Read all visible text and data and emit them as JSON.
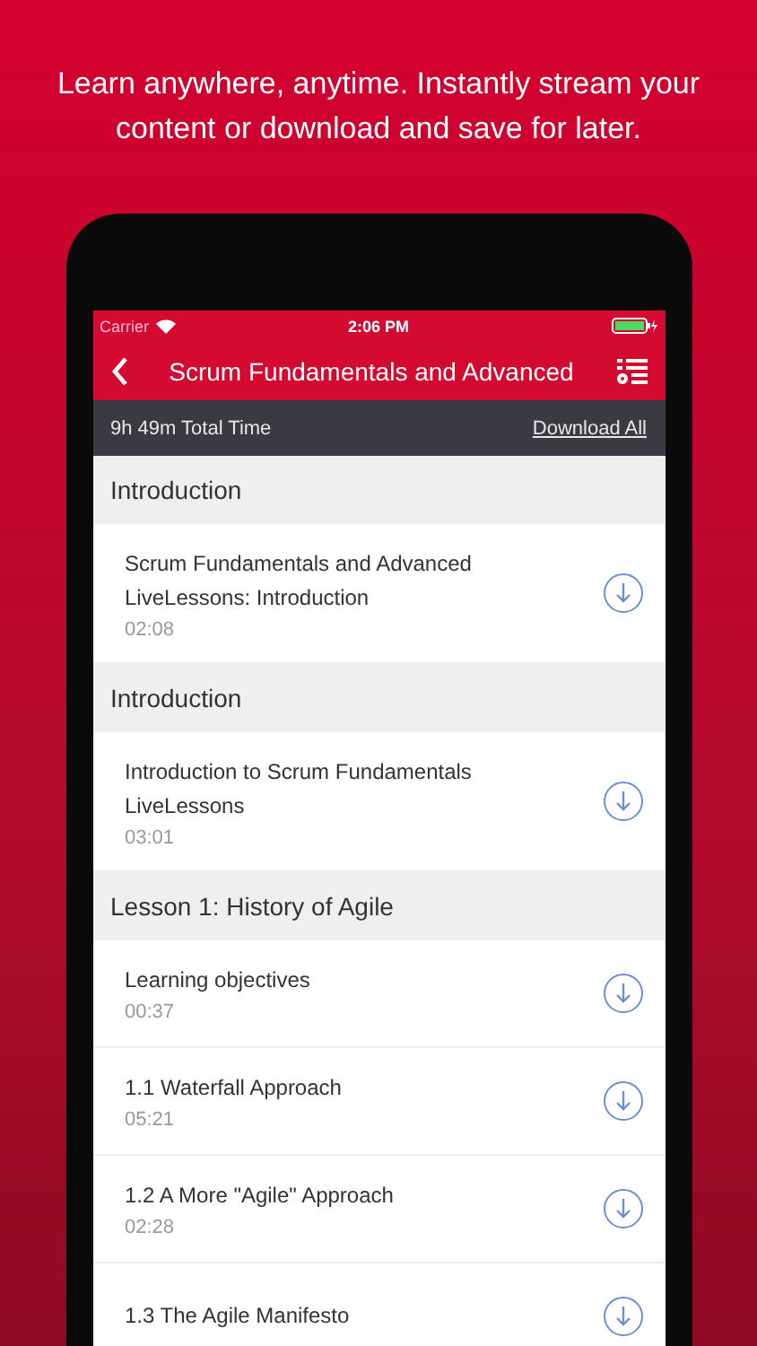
{
  "tagline": "Learn anywhere, anytime. Instantly stream your content or download and save for later.",
  "status_bar": {
    "carrier": "Carrier",
    "time": "2:06 PM"
  },
  "nav": {
    "title": "Scrum Fundamentals and Advanced"
  },
  "summary": {
    "total_time": "9h 49m Total Time",
    "action": "Download All"
  },
  "sections": [
    {
      "title": "Introduction",
      "items": [
        {
          "title": "Scrum Fundamentals and Advanced LiveLessons: Introduction",
          "duration": "02:08"
        }
      ]
    },
    {
      "title": "Introduction",
      "items": [
        {
          "title": "Introduction to Scrum Fundamentals LiveLessons",
          "duration": "03:01"
        }
      ]
    },
    {
      "title": "Lesson 1: History of Agile",
      "items": [
        {
          "title": "Learning objectives",
          "duration": "00:37"
        },
        {
          "title": "1.1 Waterfall Approach",
          "duration": "05:21"
        },
        {
          "title": "1.2 A More \"Agile\" Approach",
          "duration": "02:28"
        },
        {
          "title": "1.3 The Agile Manifesto"
        }
      ]
    }
  ]
}
